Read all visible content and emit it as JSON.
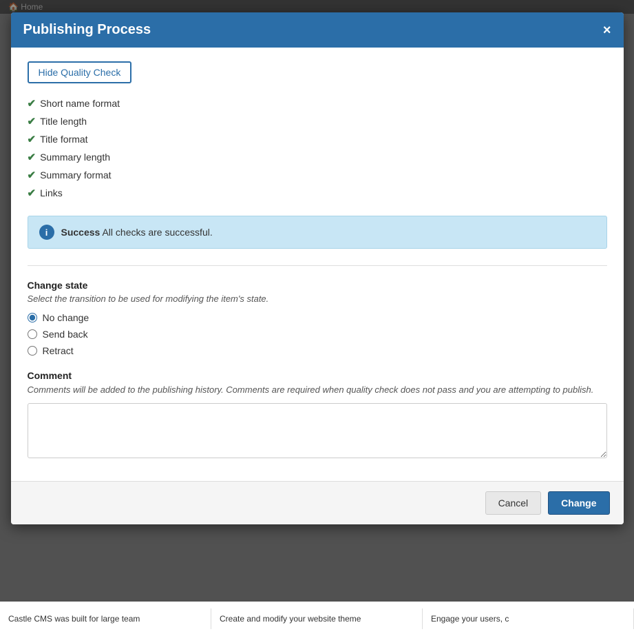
{
  "modal": {
    "title": "Publishing Process",
    "close_label": "×"
  },
  "quality_check": {
    "toggle_button": "Hide Quality Check",
    "checks": [
      "Short name format",
      "Title length",
      "Title format",
      "Summary length",
      "Summary format",
      "Links"
    ],
    "success_message": "All checks are successful.",
    "success_label": "Success"
  },
  "change_state": {
    "title": "Change state",
    "subtitle": "Select the transition to be used for modifying the item's state.",
    "options": [
      {
        "id": "no_change",
        "label": "No change",
        "checked": true
      },
      {
        "id": "send_back",
        "label": "Send back",
        "checked": false
      },
      {
        "id": "retract",
        "label": "Retract",
        "checked": false
      }
    ]
  },
  "comment": {
    "title": "Comment",
    "description": "Comments will be added to the publishing history. Comments are required when quality check does not pass and you are attempting to publish.",
    "placeholder": ""
  },
  "footer": {
    "cancel_label": "Cancel",
    "change_label": "Change"
  },
  "bottom_bar": {
    "items": [
      "Castle CMS was built for large team",
      "Create and modify your website theme",
      "Engage your users, c"
    ]
  },
  "icons": {
    "check": "✔",
    "info": "i",
    "close": "×"
  }
}
